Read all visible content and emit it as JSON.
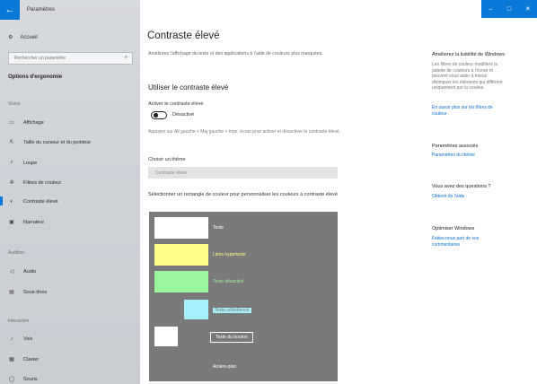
{
  "app": {
    "title": "Paramètres"
  },
  "window_controls": {
    "minimize": "–",
    "maximize": "□",
    "close": "✕"
  },
  "sidebar": {
    "home": "Accueil",
    "search_placeholder": "Rechercher un paramètre",
    "section_title": "Options d'ergonomie",
    "groups": [
      {
        "label": "Vision",
        "items": [
          "Affichage",
          "Taille du curseur et du pointeur",
          "Loupe",
          "Filtres de couleur",
          "Contraste élevé",
          "Narrateur"
        ]
      },
      {
        "label": "Audition",
        "items": [
          "Audio",
          "Sous-titres"
        ]
      },
      {
        "label": "Interaction",
        "items": [
          "Voix",
          "Clavier",
          "Souris"
        ]
      }
    ]
  },
  "main": {
    "title": "Contraste élevé",
    "description": "Améliorez l'affichage du texte et des applications à l'aide de couleurs plus marquées.",
    "subtitle": "Utiliser le contraste élevé",
    "toggle_label": "Activer le contraste élevé",
    "toggle_state": "Désactivé",
    "hint": "Appuyez sur Alt gauche + Maj gauche + Impr. écran pour activer et désactiver le contraste élevé.",
    "theme_label": "Choisir un thème",
    "theme_value": "Contraste élevé",
    "swatch_label": "Sélectionner un rectangle de couleur pour personnaliser les couleurs à contraste élevé",
    "swatches": {
      "text": "Texte",
      "hyperlinks": "Liens hypertexte",
      "disabled": "Texte désactivé",
      "selected": "Texte sélectionné",
      "button": "Texte du bouton",
      "background": "Arrière-plan"
    },
    "swatch_colors": {
      "panel": "#7a7a7a",
      "text": "#ffffff",
      "hyperlinks": "#ffff88",
      "disabled": "#9cf59c",
      "selected": "#a7f0fb",
      "button_bg": "#ffffff"
    }
  },
  "right": {
    "improve_title": "Améliorez la lisibilité de Windows",
    "improve_body": "Les filtres de couleur modifient la palette de couleurs à l'écran et peuvent vous aider à mieux distinguer les éléments qui diffèrent uniquement par la couleur.",
    "improve_link": "En savoir plus sur les filtres de couleur",
    "related_title": "Paramètres associés",
    "related_link": "Paramètres du thème",
    "questions_title": "Vous avez des questions ?",
    "questions_link": "Obtenir de l'aide",
    "improve_windows_title": "Optimiser Windows",
    "feedback_link": "Faites-nous part de vos commentaires"
  },
  "accent": "#0a78d7"
}
